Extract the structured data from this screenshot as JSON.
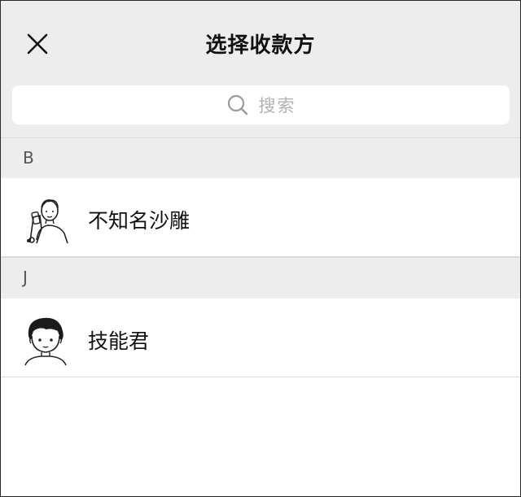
{
  "header": {
    "title": "选择收款方",
    "close_icon": "close-icon"
  },
  "search": {
    "placeholder": "搜索",
    "icon": "search-icon"
  },
  "sections": [
    {
      "letter": "B",
      "contacts": [
        {
          "name": "不知名沙雕",
          "avatar": "avatar-man-with-phone-icon"
        }
      ]
    },
    {
      "letter": "J",
      "contacts": [
        {
          "name": "技能君",
          "avatar": "avatar-boy-icon"
        }
      ]
    }
  ]
}
